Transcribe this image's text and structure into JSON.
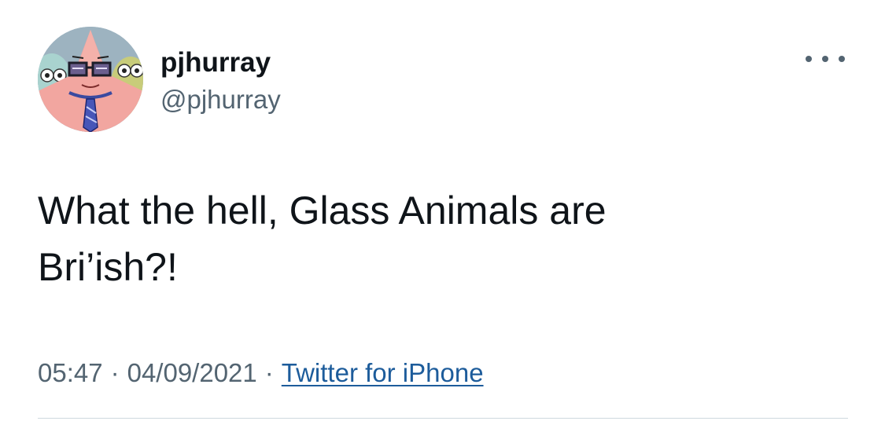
{
  "tweet": {
    "author": {
      "display_name": "pjhurray",
      "handle": "@pjhurray",
      "avatar_icon": "cartoon-avatar-icon"
    },
    "more_icon": "more-options-icon",
    "text": "What the hell, Glass Animals are\nBri’ish?!",
    "time": "05:47",
    "date": "04/09/2021",
    "separator": "·",
    "source": "Twitter for iPhone"
  },
  "colors": {
    "text_primary": "#0f1419",
    "text_secondary": "#536471",
    "link": "#1d5c9b",
    "divider": "#cfd9de"
  }
}
